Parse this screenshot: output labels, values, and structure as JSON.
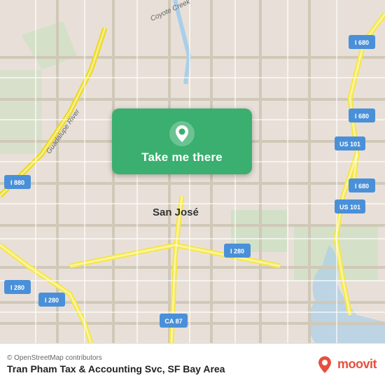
{
  "map": {
    "attribution": "© OpenStreetMap contributors",
    "location": "San José"
  },
  "button": {
    "label": "Take me there"
  },
  "footer": {
    "place_name": "Tran Pham Tax & Accounting Svc, SF Bay Area",
    "osm_credit": "© OpenStreetMap contributors",
    "moovit_label": "moovit"
  },
  "colors": {
    "button_bg": "#3aaf6f",
    "road_yellow": "#f5e642",
    "road_white": "#ffffff",
    "map_bg": "#e8e0d8",
    "highway_bg": "#f0c96e",
    "moovit_red": "#e84f3d"
  }
}
